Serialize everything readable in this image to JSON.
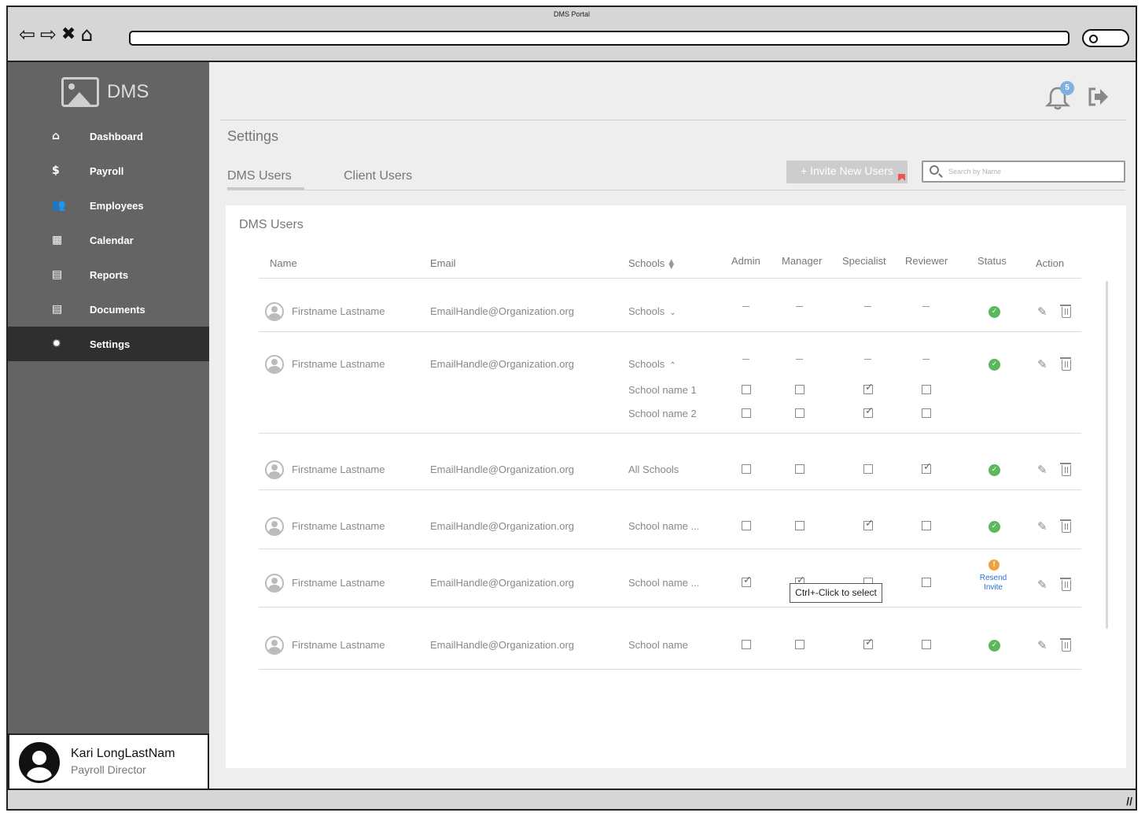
{
  "browser": {
    "window_title": "DMS Portal",
    "nav_icons": [
      "back-arrow-icon",
      "forward-arrow-icon",
      "close-x-icon",
      "home-icon"
    ],
    "search_icon": "search-icon"
  },
  "sidebar": {
    "logo_text": "DMS",
    "items": [
      {
        "label": "Dashboard",
        "icon": "home-icon",
        "glyph": "⌂",
        "active": false
      },
      {
        "label": "Payroll",
        "icon": "payroll-hand-coin-icon",
        "glyph": "$",
        "active": false
      },
      {
        "label": "Employees",
        "icon": "users-icon",
        "glyph": "👥",
        "active": false
      },
      {
        "label": "Calendar",
        "icon": "calendar-icon",
        "glyph": "▦",
        "active": false
      },
      {
        "label": "Reports",
        "icon": "report-icon",
        "glyph": "▤",
        "active": false
      },
      {
        "label": "Documents",
        "icon": "document-icon",
        "glyph": "▤",
        "active": false
      },
      {
        "label": "Settings",
        "icon": "gear-icon",
        "glyph": "✹",
        "active": true
      }
    ]
  },
  "profile": {
    "name": "Kari LongLastNam",
    "role": "Payroll Director"
  },
  "header": {
    "notification_count": "5",
    "notification_icon": "bell-icon",
    "logout_icon": "logout-icon"
  },
  "page": {
    "title": "Settings",
    "tabs": [
      {
        "label": "DMS Users",
        "active": true
      },
      {
        "label": "Client Users",
        "active": false
      }
    ],
    "invite_button": "+ Invite New Users",
    "search_placeholder": "Search by Name"
  },
  "table": {
    "title": "DMS Users",
    "columns": {
      "name": "Name",
      "email": "Email",
      "schools": "Schools",
      "admin": "Admin",
      "manager": "Manager",
      "specialist": "Specialist",
      "reviewer": "Reviewer",
      "status": "Status",
      "action": "Action"
    },
    "rows": [
      {
        "name": "Firstname Lastname",
        "email": "EmailHandle@Organization.org",
        "schools": "Schools",
        "schools_toggle": "collapsed",
        "roles": null,
        "status": "active"
      },
      {
        "name": "Firstname Lastname",
        "email": "EmailHandle@Organization.org",
        "schools": "Schools",
        "schools_toggle": "expanded",
        "roles": null,
        "status": "active",
        "sub_rows": [
          {
            "school": "School name 1",
            "roles": [
              false,
              false,
              true,
              false
            ]
          },
          {
            "school": "School name 2",
            "roles": [
              false,
              false,
              true,
              false
            ]
          }
        ]
      },
      {
        "name": "Firstname Lastname",
        "email": "EmailHandle@Organization.org",
        "schools": "All Schools",
        "roles": [
          false,
          false,
          false,
          true
        ],
        "status": "active"
      },
      {
        "name": "Firstname Lastname",
        "email": "EmailHandle@Organization.org",
        "schools": "School name ...",
        "roles": [
          false,
          false,
          true,
          false
        ],
        "status": "active"
      },
      {
        "name": "Firstname Lastname",
        "email": "EmailHandle@Organization.org",
        "schools": "School name ...",
        "roles": [
          true,
          true,
          false,
          false
        ],
        "status": "pending",
        "resend_label": "Resend Invite"
      },
      {
        "name": "Firstname Lastname",
        "email": "EmailHandle@Organization.org",
        "schools": "School name",
        "roles": [
          false,
          false,
          true,
          false
        ],
        "status": "active"
      }
    ]
  },
  "tooltip": "Ctrl+-Click to select",
  "colors": {
    "sidebar_bg": "#646464",
    "sidebar_active": "#2f2f2f",
    "status_ok": "#5cb85c",
    "status_warn": "#f0a040",
    "link_blue": "#2b6fd6",
    "badge_blue": "#7fb0e0"
  }
}
